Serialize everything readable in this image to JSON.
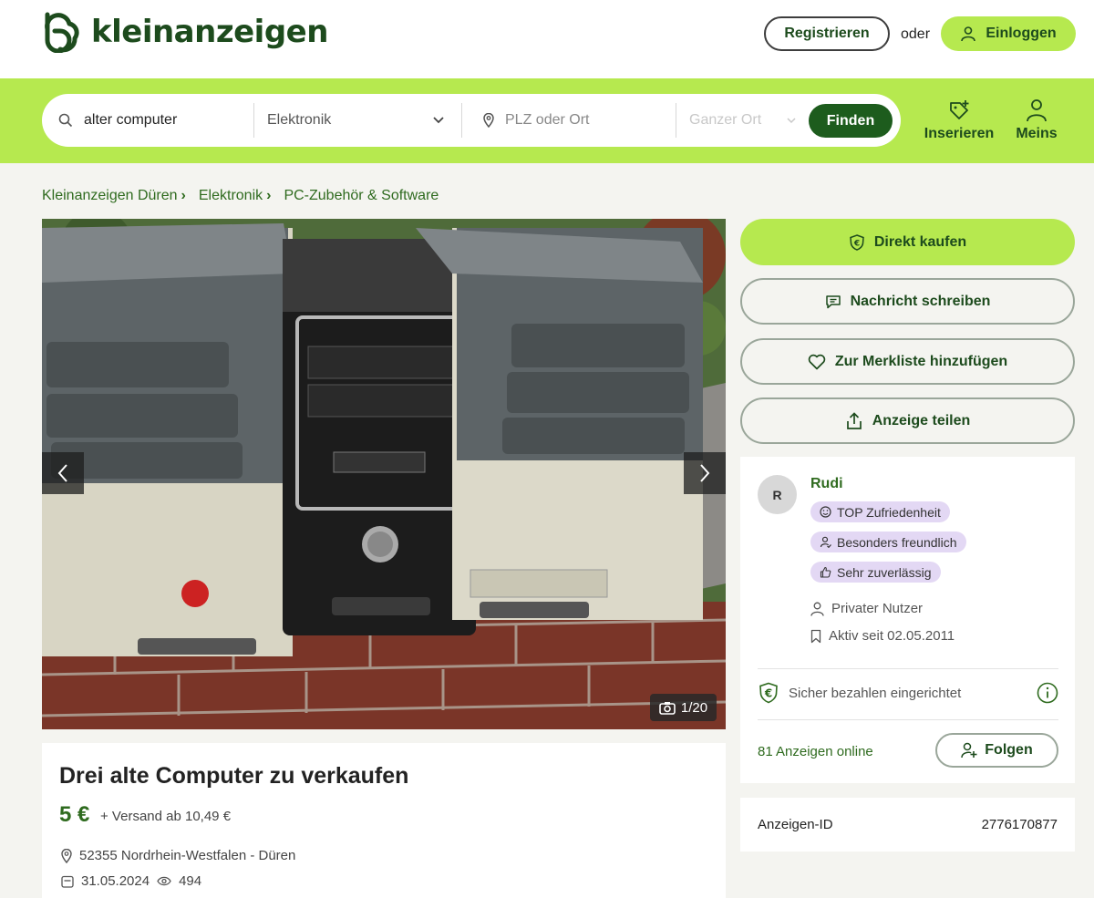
{
  "header": {
    "logo_text": "kleinanzeigen",
    "register_label": "Registrieren",
    "or_text": "oder",
    "login_label": "Einloggen"
  },
  "search": {
    "query": "alter computer",
    "category": "Elektronik",
    "location_placeholder": "PLZ oder Ort",
    "radius": "Ganzer Ort",
    "find_label": "Finden"
  },
  "header_actions": {
    "post_label": "Inserieren",
    "mine_label": "Meins"
  },
  "breadcrumb": {
    "items": [
      "Kleinanzeigen Düren",
      "Elektronik",
      "PC-Zubehör & Software"
    ],
    "sep": "›"
  },
  "gallery": {
    "counter": "1/20"
  },
  "listing": {
    "title": "Drei alte Computer zu verkaufen",
    "price": "5 €",
    "shipping": "+ Versand ab 10,49 €",
    "location": "52355 Nordrhein-Westfalen - Düren",
    "date": "31.05.2024",
    "views": "494",
    "ad_id_label": "Anzeigen-ID",
    "ad_id": "2776170877"
  },
  "actions": {
    "buy_label": "Direkt kaufen",
    "message_label": "Nachricht schreiben",
    "watchlist_label": "Zur Merkliste hinzufügen",
    "share_label": "Anzeige teilen"
  },
  "seller": {
    "initial": "R",
    "name": "Rudi",
    "badges": [
      "TOP Zufriedenheit",
      "Besonders freundlich",
      "Sehr zuverlässig"
    ],
    "type": "Privater Nutzer",
    "active_since": "Aktiv seit 02.05.2011",
    "secure_pay": "Sicher bezahlen eingerichtet",
    "ads_online": "81 Anzeigen online",
    "follow_label": "Folgen"
  },
  "colors": {
    "brand_green": "#b6e94f",
    "dark_green": "#1d5c1d",
    "text_green": "#2f6b1f",
    "badge_purple": "#e3d8f4"
  }
}
